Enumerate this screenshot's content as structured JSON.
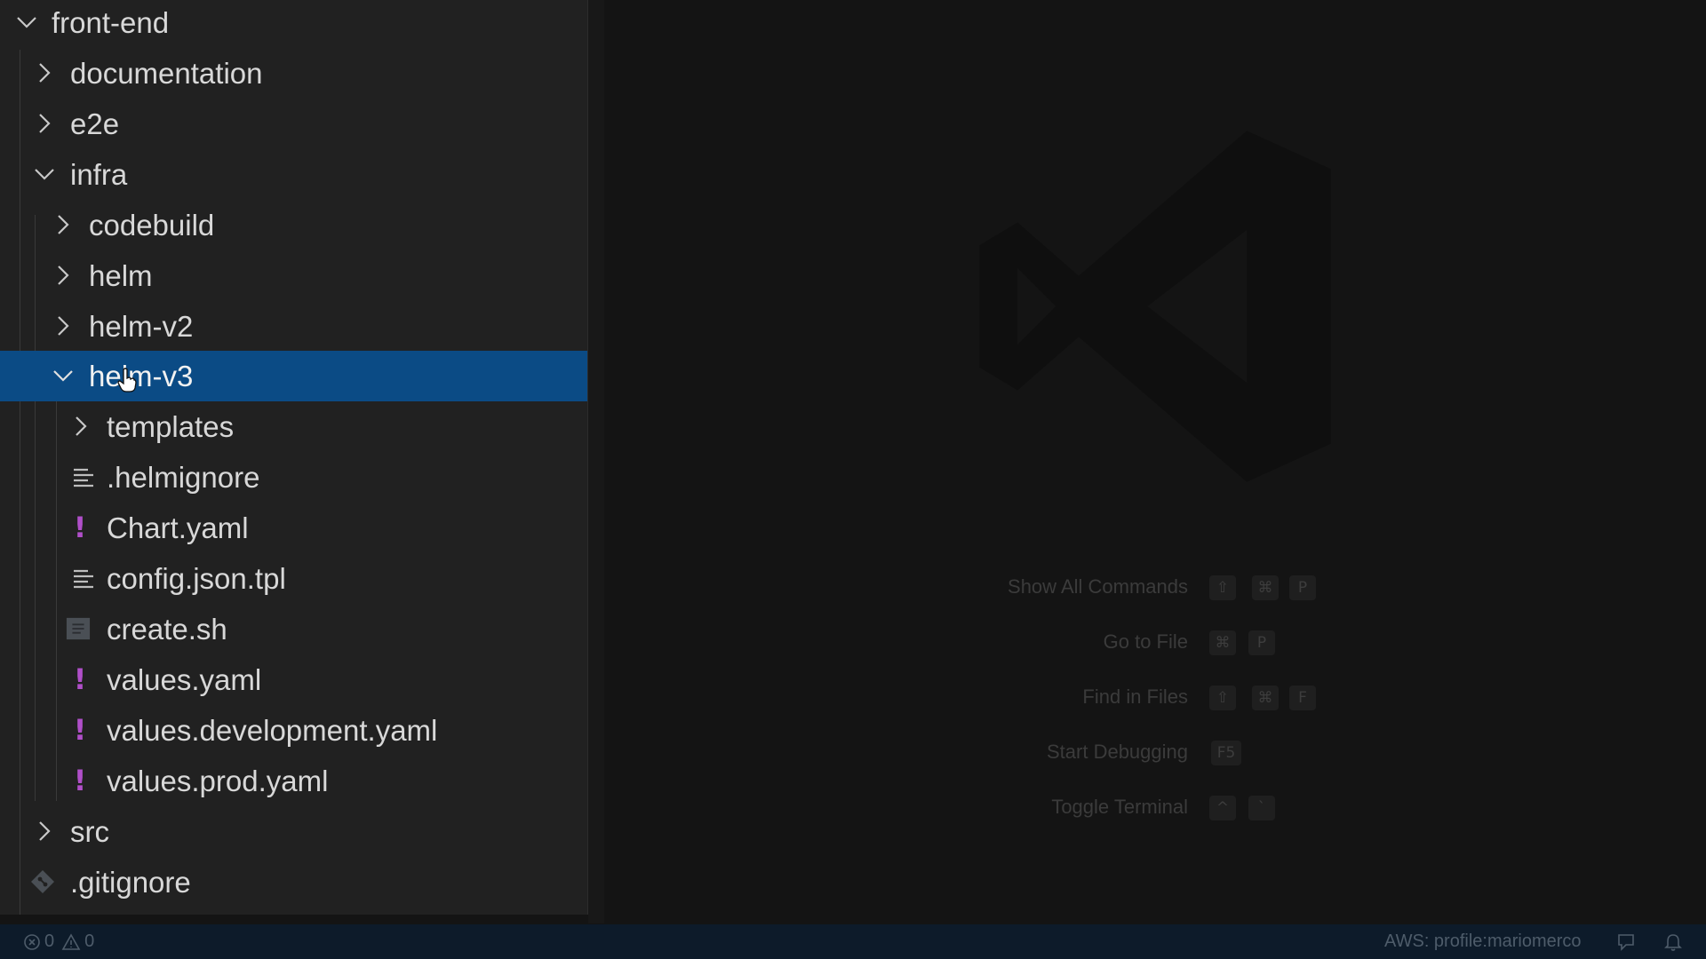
{
  "explorer": {
    "tree": [
      {
        "label": "front-end",
        "type": "folder",
        "expanded": true
      },
      {
        "label": "documentation",
        "type": "folder",
        "expanded": false
      },
      {
        "label": "e2e",
        "type": "folder",
        "expanded": false
      },
      {
        "label": "infra",
        "type": "folder",
        "expanded": true
      },
      {
        "label": "codebuild",
        "type": "folder",
        "expanded": false
      },
      {
        "label": "helm",
        "type": "folder",
        "expanded": false
      },
      {
        "label": "helm-v2",
        "type": "folder",
        "expanded": false
      },
      {
        "label": "helm-v3",
        "type": "folder",
        "expanded": true,
        "selected": true
      },
      {
        "label": "templates",
        "type": "folder",
        "expanded": false
      },
      {
        "label": ".helmignore",
        "type": "file",
        "icon": "text-lines-icon"
      },
      {
        "label": "Chart.yaml",
        "type": "file",
        "icon": "yaml-icon"
      },
      {
        "label": "config.json.tpl",
        "type": "file",
        "icon": "text-lines-icon"
      },
      {
        "label": "create.sh",
        "type": "file",
        "icon": "shell-script-icon"
      },
      {
        "label": "values.yaml",
        "type": "file",
        "icon": "yaml-icon"
      },
      {
        "label": "values.development.yaml",
        "type": "file",
        "icon": "yaml-icon"
      },
      {
        "label": "values.prod.yaml",
        "type": "file",
        "icon": "yaml-icon"
      },
      {
        "label": "src",
        "type": "folder",
        "expanded": false
      },
      {
        "label": ".gitignore",
        "type": "file",
        "icon": "git-icon"
      }
    ]
  },
  "welcome": {
    "logo_icon": "vscode-logo-watermark",
    "commands": [
      {
        "label": "Show All Commands",
        "keys": [
          "⇧",
          "⌘",
          "P"
        ]
      },
      {
        "label": "Go to File",
        "keys": [
          "⌘",
          "P"
        ]
      },
      {
        "label": "Find in Files",
        "keys": [
          "⇧",
          "⌘",
          "F"
        ]
      },
      {
        "label": "Start Debugging",
        "keys": [
          "F5"
        ]
      },
      {
        "label": "Toggle Terminal",
        "keys": [
          "^",
          "`"
        ]
      }
    ]
  },
  "status_bar": {
    "errors": "0",
    "warnings": "0",
    "aws_profile": "AWS: profile:mariomerco"
  },
  "colors": {
    "selection": "#0b4b85",
    "yaml_icon": "#b04fc9",
    "status_bar_bg": "#0d1b2a"
  }
}
